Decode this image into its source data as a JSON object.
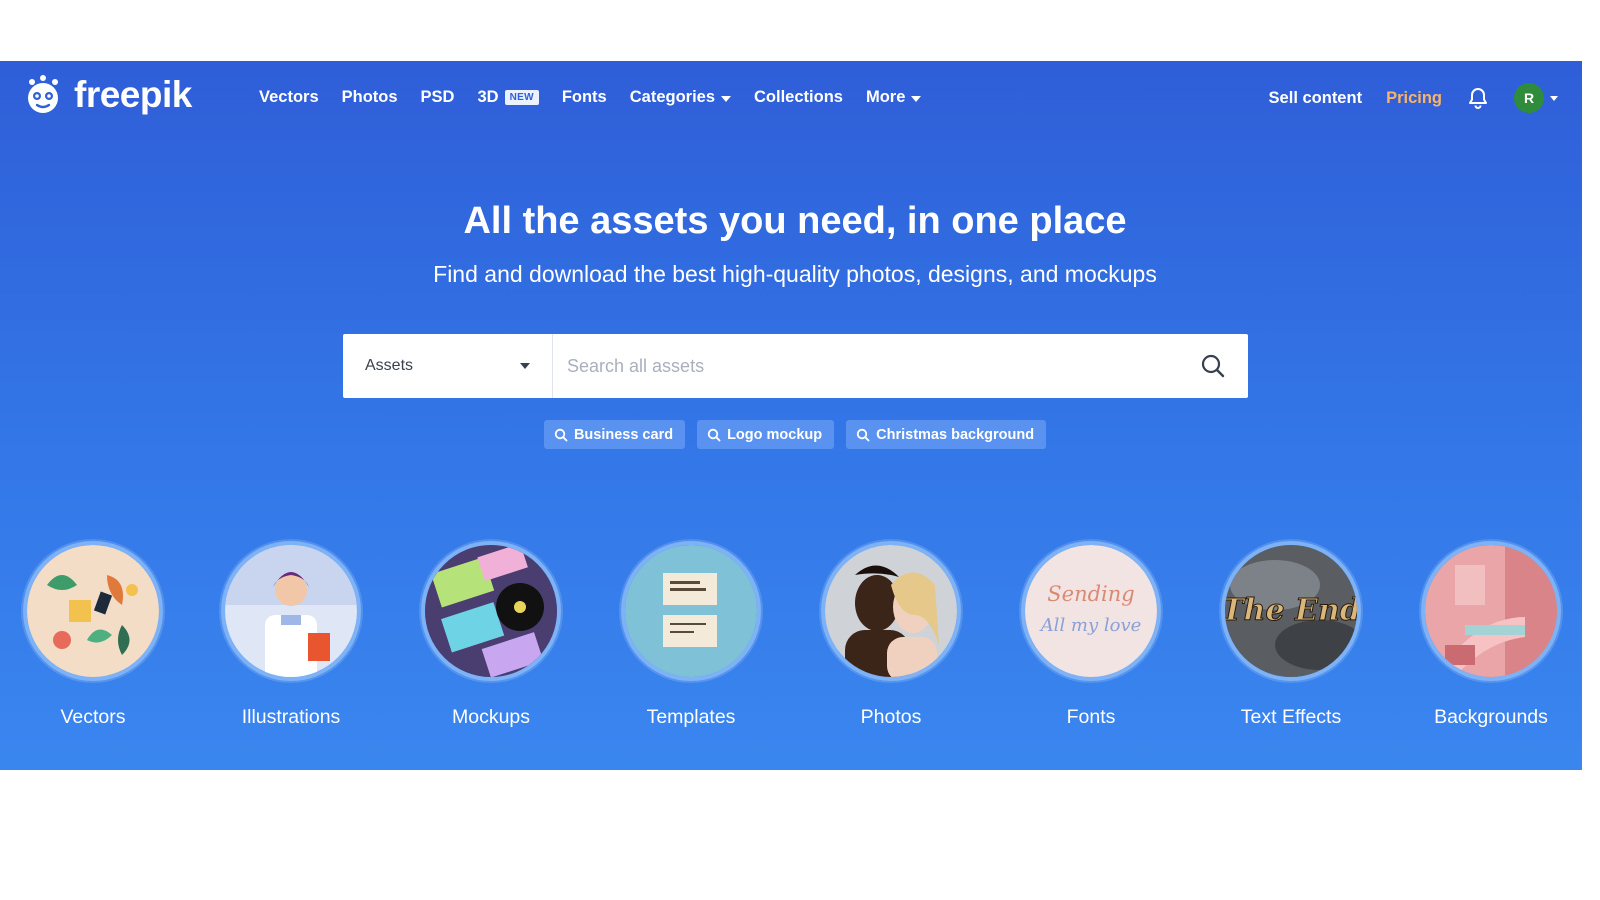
{
  "brand": {
    "name": "freepik"
  },
  "nav": {
    "items": [
      {
        "label": "Vectors"
      },
      {
        "label": "Photos"
      },
      {
        "label": "PSD"
      },
      {
        "label": "3D",
        "badge": "NEW"
      },
      {
        "label": "Fonts"
      },
      {
        "label": "Categories"
      },
      {
        "label": "Collections"
      },
      {
        "label": "More"
      }
    ],
    "sell_label": "Sell content",
    "pricing_label": "Pricing",
    "avatar_initial": "R"
  },
  "hero": {
    "title": "All the assets you need, in one place",
    "subtitle": "Find and download the best high-quality photos, designs, and mockups"
  },
  "search": {
    "type_selected": "Assets",
    "placeholder": "Search all assets",
    "suggestions": [
      "Business card",
      "Logo mockup",
      "Christmas background"
    ]
  },
  "categories": [
    {
      "label": "Vectors",
      "icon": "vectors-thumbnail"
    },
    {
      "label": "Illustrations",
      "icon": "illustrations-thumbnail"
    },
    {
      "label": "Mockups",
      "icon": "mockups-thumbnail"
    },
    {
      "label": "Templates",
      "icon": "templates-thumbnail"
    },
    {
      "label": "Photos",
      "icon": "photos-thumbnail"
    },
    {
      "label": "Fonts",
      "icon": "fonts-thumbnail",
      "sample_text": "Sending All my love"
    },
    {
      "label": "Text Effects",
      "icon": "text-effects-thumbnail",
      "sample_text": "The End"
    },
    {
      "label": "Backgrounds",
      "icon": "backgrounds-thumbnail"
    }
  ],
  "colors": {
    "accent": "#2f5ed8",
    "pricing": "#f7b36b",
    "avatar": "#2f8c3a"
  }
}
